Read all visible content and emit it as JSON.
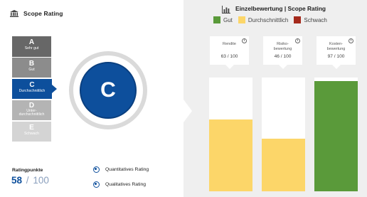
{
  "header": {
    "title": "Scope Rating",
    "icon": "bank-icon"
  },
  "scale": [
    {
      "letter": "A",
      "label": "Sehr gut"
    },
    {
      "letter": "B",
      "label": "Gut"
    },
    {
      "letter": "C",
      "label": "Durchschnittlich"
    },
    {
      "letter": "D",
      "label": "Unter-\ndurchschnittlich"
    },
    {
      "letter": "E",
      "label": "Schwach"
    }
  ],
  "selected_grade": "C",
  "rating": {
    "label": "Ratingpunkte",
    "value": "58",
    "separator": "/",
    "max": "100"
  },
  "options": [
    {
      "label": "Quantitatives Rating",
      "selected": false
    },
    {
      "label": "Qualitatives Rating",
      "selected": true
    }
  ],
  "panel": {
    "title": "Einzelbewertung | Scope Rating",
    "icon": "bar-chart-icon"
  },
  "legend": [
    {
      "label": "Gut",
      "color": "#5a9a3a"
    },
    {
      "label": "Durchschnittlich",
      "color": "#fcd669"
    },
    {
      "label": "Schwach",
      "color": "#a52a1c"
    }
  ],
  "categories": [
    {
      "label": "Rendite",
      "score": "63 / 100",
      "value": 63,
      "color": "#fcd669"
    },
    {
      "label": "Risiko-\nbewertung",
      "score": "46 / 100",
      "value": 46,
      "color": "#fcd669"
    },
    {
      "label": "Kosten-\nbewertung",
      "score": "97 / 100",
      "value": 97,
      "color": "#5a9a3a"
    }
  ]
}
